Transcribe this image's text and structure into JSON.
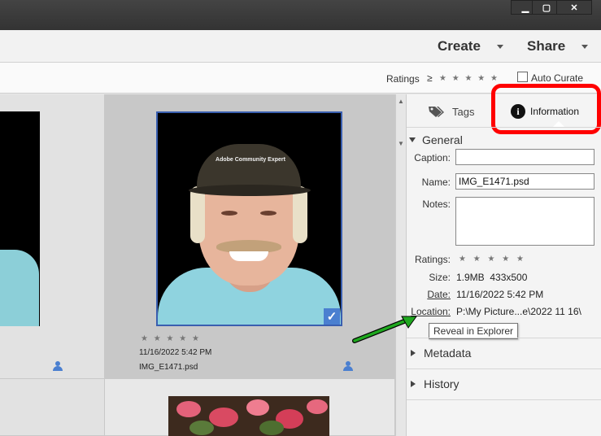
{
  "menubar": {
    "create_label": "Create",
    "share_label": "Share"
  },
  "ratingsbar": {
    "ratings_label": "Ratings",
    "gte_symbol": "≥",
    "stars": "★ ★ ★ ★ ★",
    "auto_curate_label": "Auto Curate"
  },
  "grid": {
    "photo_stars": "★ ★ ★ ★ ★",
    "photo_date": "11/16/2022 5:42 PM",
    "photo_filename": "IMG_E1471.psd",
    "cap_text": "Adobe Community Expert"
  },
  "panel": {
    "tabs": [
      {
        "label": "Tags"
      },
      {
        "label": "Information"
      }
    ],
    "general_label": "General",
    "caption_label": "Caption:",
    "name_label": "Name:",
    "name_value": "IMG_E1471.psd",
    "notes_label": "Notes:",
    "ratings_label": "Ratings:",
    "ratings_stars": "★ ★ ★ ★ ★",
    "size_label": "Size:",
    "size_value": "1.9MB  433x500",
    "date_label": "Date:",
    "date_value": "11/16/2022 5:42 PM",
    "location_label": "Location:",
    "location_value": "P:\\My Picture...e\\2022 11 16\\",
    "tooltip": "Reveal in Explorer",
    "metadata_label": "Metadata",
    "history_label": "History"
  },
  "colors": {
    "highlight_red": "#ff0000",
    "arrow_green": "#1fa81f",
    "selected_border": "#3a5fb0",
    "check_blue": "#4a7fd0"
  }
}
